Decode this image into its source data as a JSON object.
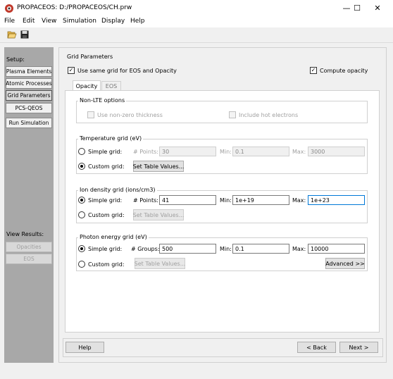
{
  "window": {
    "title": "PROPACEOS:  D:/PROPACEOS/CH.prw",
    "minimize": "—",
    "maximize": "☐",
    "close": "✕"
  },
  "menu": [
    "File",
    "Edit",
    "View",
    "Simulation",
    "Display",
    "Help"
  ],
  "toolbar": {
    "open_icon": "folder-open-icon",
    "save_icon": "save-icon"
  },
  "sidebar": {
    "setup_heading": "Setup:",
    "setup_items": [
      "Plasma Elements",
      "Atomic Processes",
      "Grid Parameters",
      "PCS-QEOS",
      "Run Simulation"
    ],
    "results_heading": "View Results:",
    "results_items": [
      "Opacities",
      "EOS"
    ]
  },
  "section_title": "Grid Parameters",
  "use_same_grid": {
    "label": "Use same grid for EOS and Opacity",
    "checked": true
  },
  "compute_opacity": {
    "label": "Compute opacity",
    "checked": true
  },
  "tabs": [
    "Opacity",
    "EOS"
  ],
  "nonlte": {
    "title": "Non-LTE options",
    "nonzero_thickness": "Use non-zero thickness",
    "hot_electrons": "Include hot electrons"
  },
  "temperature": {
    "title": "Temperature grid (eV)",
    "simple": "Simple grid:",
    "custom": "Custom grid:",
    "points_label": "# Points:",
    "points": "30",
    "min_label": "Min:",
    "min": "0.1",
    "max_label": "Max:",
    "max": "3000",
    "set_table": "Set Table Values..."
  },
  "ion_density": {
    "title": "Ion density grid (ions/cm3)",
    "simple": "Simple grid:",
    "custom": "Custom grid:",
    "points_label": "# Points:",
    "points": "41",
    "min_label": "Min:",
    "min": "1e+19",
    "max_label": "Max:",
    "max": "1e+23",
    "set_table": "Set Table Values..."
  },
  "photon": {
    "title": "Photon energy grid (eV)",
    "simple": "Simple grid:",
    "custom": "Custom grid:",
    "groups_label": "# Groups:",
    "groups": "500",
    "min_label": "Min:",
    "min": "0.1",
    "max_label": "Max:",
    "max": "10000",
    "set_table": "Set Table Values...",
    "advanced": "Advanced >>"
  },
  "footer": {
    "help": "Help",
    "back": "< Back",
    "next": "Next >"
  }
}
